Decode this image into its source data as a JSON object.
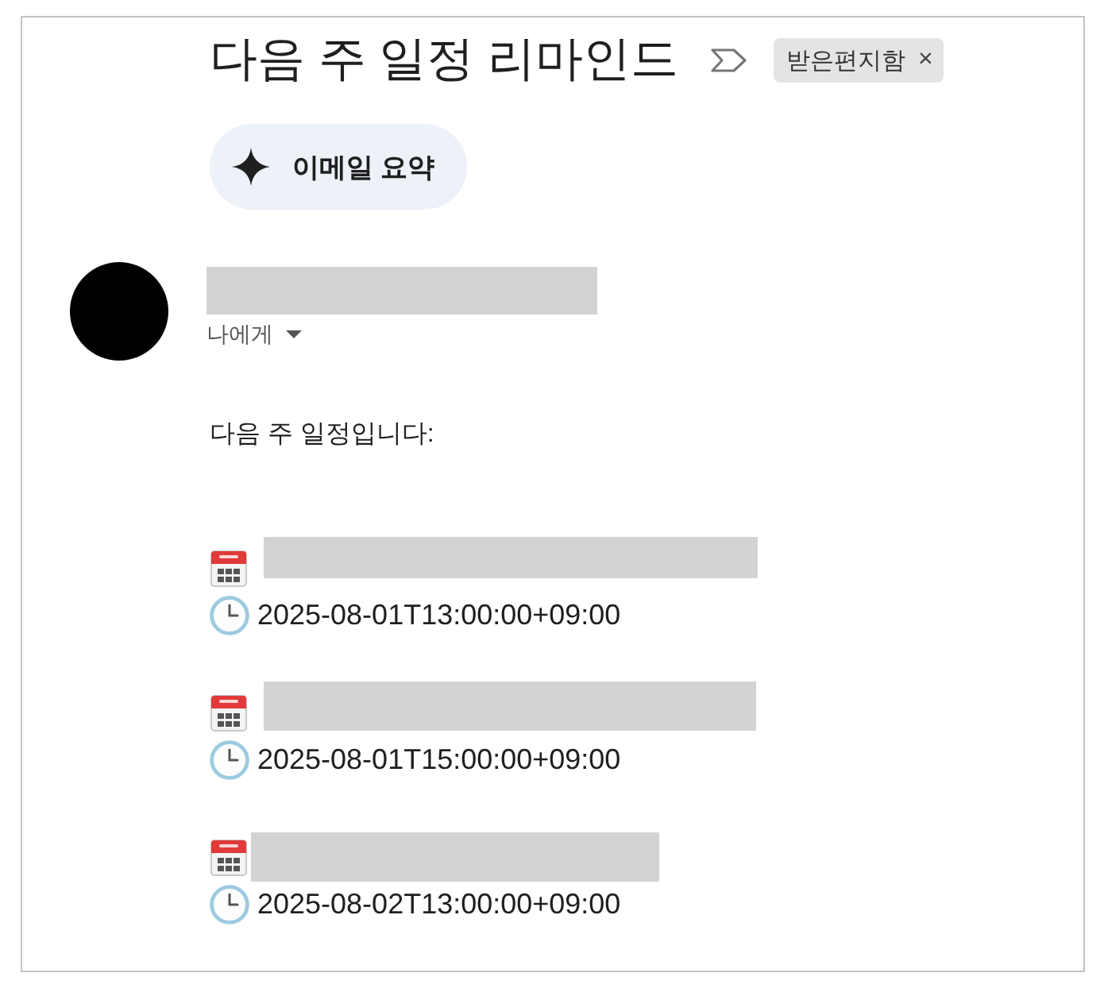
{
  "email": {
    "subject": "다음 주 일정 리마인드",
    "important": false,
    "labels": [
      {
        "text": "받은편지함",
        "remove_symbol": "×"
      }
    ]
  },
  "summary_button": {
    "label": "이메일 요약"
  },
  "sender": {
    "name_redacted": true,
    "recipient": "나에게"
  },
  "body": {
    "greeting": "다음 주 일정입니다:",
    "events": [
      {
        "title_redacted": true,
        "datetime": "2025-08-01T13:00:00+09:00"
      },
      {
        "title_redacted": true,
        "datetime": "2025-08-01T15:00:00+09:00"
      },
      {
        "title_redacted": true,
        "datetime": "2025-08-02T13:00:00+09:00"
      }
    ]
  }
}
